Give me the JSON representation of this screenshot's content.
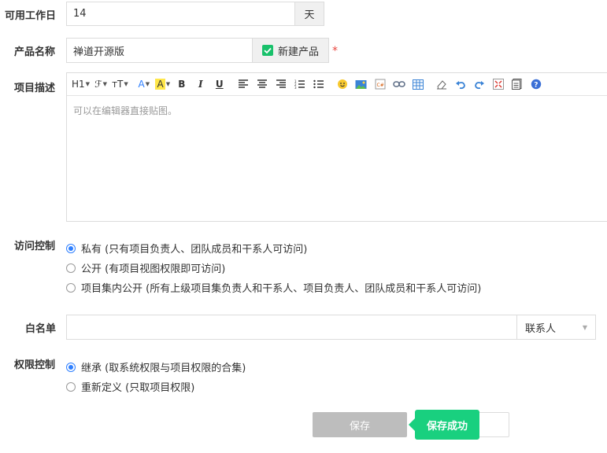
{
  "workdays": {
    "label": "可用工作日",
    "value": "14",
    "unit": "天"
  },
  "product": {
    "label": "产品名称",
    "value": "禅道开源版",
    "new_product_label": "新建产品",
    "required_mark": "*"
  },
  "description": {
    "label": "项目描述",
    "placeholder": "可以在编辑器直接贴图。",
    "toolbar": {
      "heading": "H1",
      "font": "ℱ",
      "size": "тT",
      "color": "A",
      "highlight": "A",
      "bold": "B",
      "italic": "I",
      "underline": "U"
    }
  },
  "access": {
    "label": "访问控制",
    "options": [
      {
        "text": "私有 (只有项目负责人、团队成员和干系人可访问)",
        "selected": true
      },
      {
        "text": "公开 (有项目视图权限即可访问)",
        "selected": false
      },
      {
        "text": "项目集内公开 (所有上级项目集负责人和干系人、项目负责人、团队成员和干系人可访问)",
        "selected": false
      }
    ]
  },
  "whitelist": {
    "label": "白名单",
    "value": "",
    "select_value": "联系人"
  },
  "permission": {
    "label": "权限控制",
    "options": [
      {
        "text": "继承 (取系统权限与项目权限的合集)",
        "selected": true
      },
      {
        "text": "重新定义 (只取项目权限)",
        "selected": false
      }
    ]
  },
  "actions": {
    "save_label": "保存",
    "toast": "保存成功"
  },
  "colors": {
    "accent": "#2e7fff",
    "success": "#19d07f",
    "required": "#e9463f",
    "disabled": "#bdbdbd"
  }
}
